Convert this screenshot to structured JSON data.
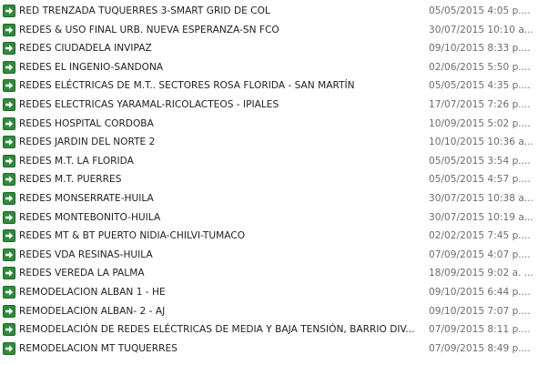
{
  "files": [
    {
      "name": "RED TRENZADA TUQUERRES 3-SMART GRID DE COL",
      "date": "05/05/2015 4:05 p....",
      "icon": "shortcut-arrow-icon"
    },
    {
      "name": "REDES & USO FINAL URB. NUEVA ESPERANZA-SN FCO",
      "date": "30/07/2015 10:10 a...",
      "icon": "shortcut-arrow-icon"
    },
    {
      "name": "REDES CIUDADELA  INVIPAZ",
      "date": "09/10/2015 8:33 p....",
      "icon": "shortcut-arrow-icon"
    },
    {
      "name": "REDES EL INGENIO-SANDONA",
      "date": "02/06/2015 5:50 p....",
      "icon": "shortcut-arrow-icon"
    },
    {
      "name": "REDES ELÉCTRICAS DE M.T.. SECTORES ROSA FLORIDA - SAN MARTÍN",
      "date": "05/05/2015 4:35 p....",
      "icon": "shortcut-arrow-icon"
    },
    {
      "name": "REDES ELECTRICAS YARAMAL-RICOLACTEOS - IPIALES",
      "date": "17/07/2015 7:26 p....",
      "icon": "shortcut-arrow-icon"
    },
    {
      "name": "REDES HOSPITAL CORDOBA",
      "date": "10/09/2015 5:02 p....",
      "icon": "shortcut-arrow-icon"
    },
    {
      "name": "REDES JARDIN DEL NORTE 2",
      "date": "10/10/2015 10:36 a...",
      "icon": "shortcut-arrow-icon"
    },
    {
      "name": "REDES M.T. LA FLORIDA",
      "date": "05/05/2015 3:54 p....",
      "icon": "shortcut-arrow-icon"
    },
    {
      "name": "REDES M.T. PUERRES",
      "date": "05/05/2015 4:57 p....",
      "icon": "shortcut-arrow-icon"
    },
    {
      "name": "REDES MONSERRATE-HUILA",
      "date": "30/07/2015 10:38 a...",
      "icon": "shortcut-arrow-icon"
    },
    {
      "name": "REDES MONTEBONITO-HUILA",
      "date": "30/07/2015 10:19 a...",
      "icon": "shortcut-arrow-icon"
    },
    {
      "name": "REDES MT & BT PUERTO NIDIA-CHILVI-TUMACO",
      "date": "02/02/2015 7:45 p....",
      "icon": "shortcut-arrow-icon"
    },
    {
      "name": "REDES VDA RESINAS-HUILA",
      "date": "07/09/2015 4:07 p....",
      "icon": "shortcut-arrow-icon"
    },
    {
      "name": "REDES VEREDA LA PALMA",
      "date": "18/09/2015 9:02 a. ...",
      "icon": "shortcut-arrow-icon"
    },
    {
      "name": "REMODELACION ALBAN 1 - HE",
      "date": "09/10/2015 6:44 p....",
      "icon": "shortcut-arrow-icon"
    },
    {
      "name": "REMODELACION ALBAN- 2 -  AJ",
      "date": "09/10/2015 7:07 p....",
      "icon": "shortcut-arrow-icon"
    },
    {
      "name": "REMODELACIÓN DE REDES ELÉCTRICAS DE MEDIA Y BAJA TENSIÓN,  BARRIO DIV...",
      "date": "07/09/2015 8:11 p....",
      "icon": "shortcut-arrow-icon"
    },
    {
      "name": "REMODELACION MT TUQUERRES",
      "date": "07/09/2015 8:49 p....",
      "icon": "shortcut-arrow-icon"
    }
  ],
  "colors": {
    "icon_bg": "#2e8b3a",
    "icon_border": "#1d6b27",
    "date_text": "#6d6d6d",
    "name_text": "#1e1e1e"
  }
}
